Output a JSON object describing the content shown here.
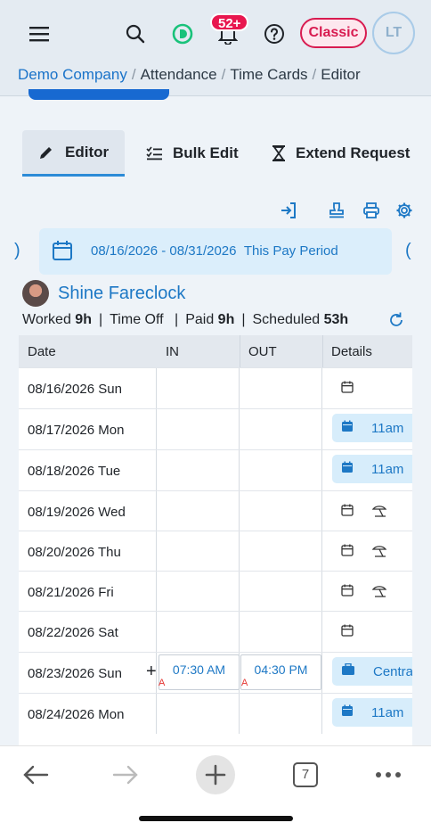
{
  "header": {
    "notifications_badge": "52+",
    "mode_button": "Classic",
    "user_initials": "LT",
    "icons": [
      "hamburger-icon",
      "search-icon",
      "d-logo-icon",
      "bell-icon",
      "help-icon"
    ]
  },
  "breadcrumb": {
    "company": "Demo Company",
    "items": [
      "Attendance",
      "Time Cards",
      "Editor"
    ]
  },
  "tabs": [
    {
      "label": "Editor",
      "icon": "pencil-icon",
      "active": true
    },
    {
      "label": "Bulk Edit",
      "icon": "checklist-icon",
      "active": false
    },
    {
      "label": "Extend Request",
      "icon": "hourglass-icon",
      "active": false
    }
  ],
  "toolbar_icons": [
    "login-icon",
    "stamp-icon",
    "print-icon",
    "settings-icon"
  ],
  "pay_period": {
    "range": "08/16/2026 - 08/31/2026",
    "label": "This Pay Period"
  },
  "employee": {
    "name": "Shine Fareclock"
  },
  "summary": {
    "worked_label": "Worked",
    "worked_value": "9h",
    "timeoff_label": "Time Off",
    "paid_label": "Paid",
    "paid_value": "9h",
    "scheduled_label": "Scheduled",
    "scheduled_value": "53h"
  },
  "table": {
    "columns": [
      "Date",
      "IN",
      "OUT",
      "Details"
    ],
    "rows": [
      {
        "date": "08/16/2026 Sun",
        "in": "",
        "out": "",
        "details": "calendar"
      },
      {
        "date": "08/17/2026 Mon",
        "in": "",
        "out": "",
        "details_pill": "11am"
      },
      {
        "date": "08/18/2026 Tue",
        "in": "",
        "out": "",
        "details_pill": "11am"
      },
      {
        "date": "08/19/2026 Wed",
        "in": "",
        "out": "",
        "details": "calendar+beach"
      },
      {
        "date": "08/20/2026 Thu",
        "in": "",
        "out": "",
        "details": "calendar+beach"
      },
      {
        "date": "08/21/2026 Fri",
        "in": "",
        "out": "",
        "details": "calendar+beach"
      },
      {
        "date": "08/22/2026 Sat",
        "in": "",
        "out": "",
        "details": "calendar"
      },
      {
        "date": "08/23/2026 Sun",
        "in": "07:30 AM",
        "out": "04:30 PM",
        "in_mark": "A",
        "out_mark": "A",
        "details_pill": "Centra"
      },
      {
        "date": "08/24/2026 Mon",
        "in": "",
        "out": "",
        "details_pill": "11am"
      }
    ]
  },
  "browser": {
    "tab_count": "7"
  },
  "colors": {
    "accent": "#1d78c5",
    "badge": "#e8174f",
    "classic": "#d81b50"
  }
}
